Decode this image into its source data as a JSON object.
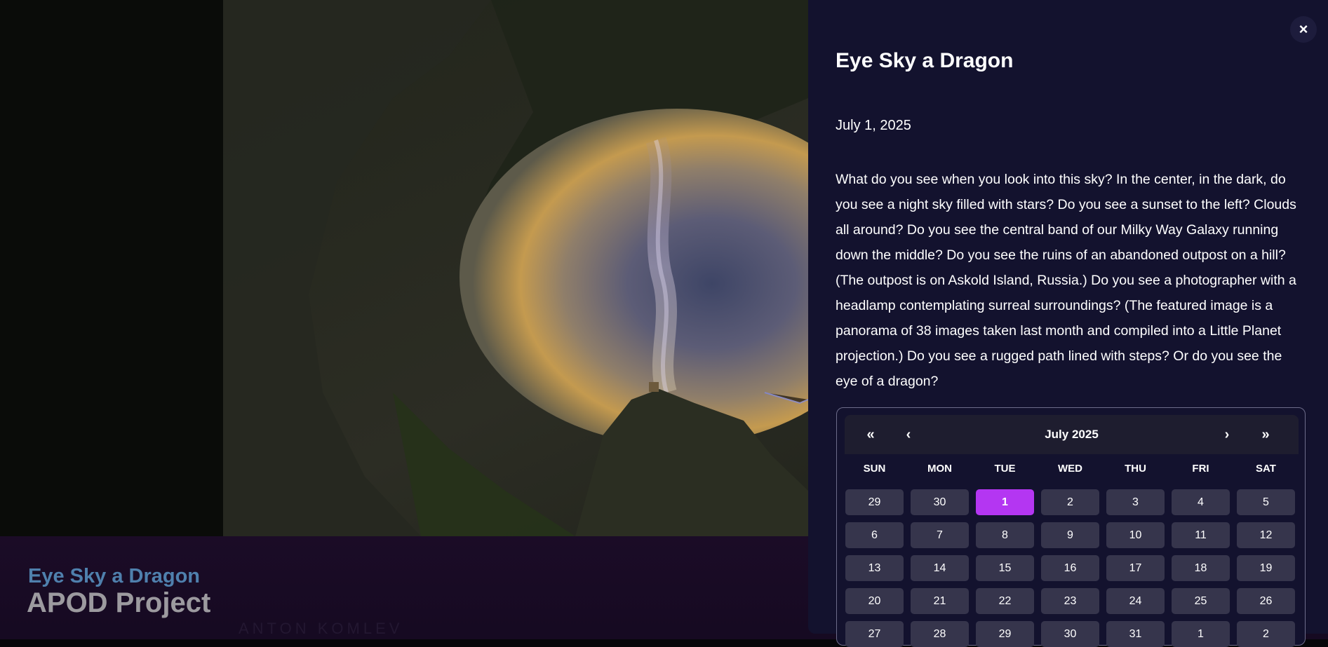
{
  "caption": {
    "title": "Eye Sky a Dragon",
    "project": "APOD Project",
    "credit": "ANTON KOMLEV"
  },
  "panel": {
    "close_label": "×",
    "title": "Eye Sky a Dragon",
    "date": "July 1, 2025",
    "description": "What do you see when you look into this sky? In the center, in the dark, do you see a night sky filled with stars? Do you see a sunset to the left? Clouds all around? Do you see the central band of our Milky Way Galaxy running down the middle? Do you see the ruins of an abandoned outpost on a hill? (The outpost is on Askold Island, Russia.) Do you see a photographer with a headlamp contemplating surreal surroundings? (The featured image is a panorama of 38 images taken last month and compiled into a Little Planet projection.) Do you see a rugged path lined with steps? Or do you see the eye of a dragon?"
  },
  "calendar": {
    "month_label": "July 2025",
    "nav": {
      "prev_year": "«",
      "prev_month": "‹",
      "next_month": "›",
      "next_year": "»"
    },
    "weekdays": [
      "SUN",
      "MON",
      "TUE",
      "WED",
      "THU",
      "FRI",
      "SAT"
    ],
    "weeks": [
      [
        "29",
        "30",
        "1",
        "2",
        "3",
        "4",
        "5"
      ],
      [
        "6",
        "7",
        "8",
        "9",
        "10",
        "11",
        "12"
      ],
      [
        "13",
        "14",
        "15",
        "16",
        "17",
        "18",
        "19"
      ],
      [
        "20",
        "21",
        "22",
        "23",
        "24",
        "25",
        "26"
      ],
      [
        "27",
        "28",
        "29",
        "30",
        "31",
        "1",
        "2"
      ]
    ],
    "selected_day": "1",
    "accent_color": "#b436f2"
  }
}
